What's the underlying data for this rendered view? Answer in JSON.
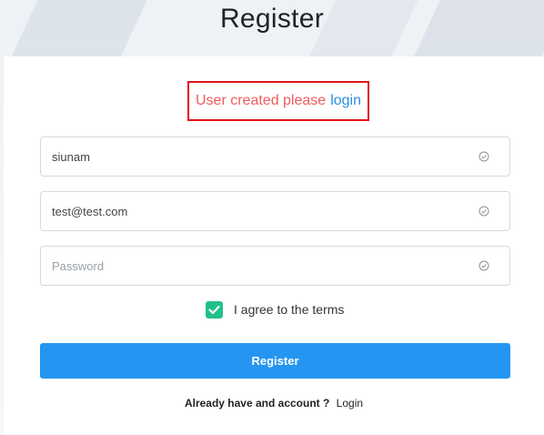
{
  "header": {
    "title": "Register"
  },
  "notice": {
    "message": "User created please",
    "link_label": "login",
    "color_message": "#f05b5b",
    "color_link": "#2a8de0",
    "border_color": "#e0141a"
  },
  "form": {
    "username": {
      "value": "siunam",
      "icon": "check-circle-icon"
    },
    "email": {
      "value": "test@test.com",
      "icon": "check-circle-icon"
    },
    "password": {
      "value": "",
      "placeholder": "Password",
      "icon": "check-circle-icon"
    },
    "terms": {
      "checked": true,
      "label": "I agree to the terms",
      "color": "#21c08a"
    },
    "submit_label": "Register",
    "submit_color": "#2496f1"
  },
  "footer": {
    "question": "Already have and account ?",
    "login_label": "Login"
  }
}
